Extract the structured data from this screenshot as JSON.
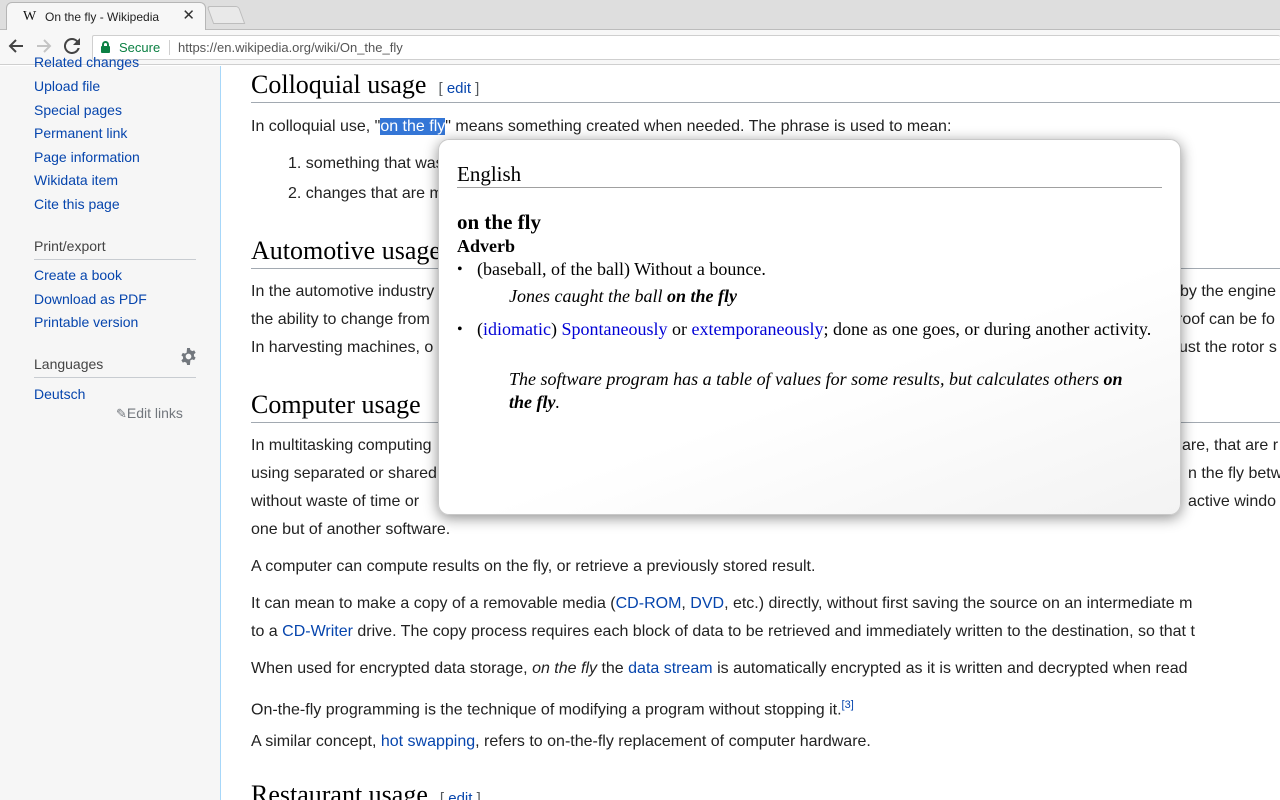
{
  "browser": {
    "tab_title": "On the fly - Wikipedia",
    "tab_favicon": "W",
    "tab_close": "✕",
    "secure_label": "Secure",
    "url": "https://en.wikipedia.org/wiki/On_the_fly"
  },
  "sidebar": {
    "tools_links": [
      "Related changes",
      "Upload file",
      "Special pages",
      "Permanent link",
      "Page information",
      "Wikidata item",
      "Cite this page"
    ],
    "print_heading": "Print/export",
    "print_links": [
      "Create a book",
      "Download as PDF",
      "Printable version"
    ],
    "languages_heading": "Languages",
    "languages": [
      "Deutsch"
    ],
    "edit_links": "Edit links"
  },
  "article": {
    "edit_label": "edit",
    "sections": {
      "colloquial_heading": "Colloquial usage",
      "automotive_heading": "Automotive usage",
      "computer_heading": "Computer usage",
      "restaurant_heading": "Restaurant usage"
    },
    "colloquial": {
      "intro_before": "In colloquial use, \"",
      "intro_selected": "on the fly",
      "intro_after": "\" means something created when needed. The phrase is used to mean:",
      "item1": "something that was",
      "item2": "changes that are m"
    },
    "automotive": {
      "line1_left": "In the automotive industry",
      "line1_right": "by the engine",
      "line2_left": "the ability to change from",
      "line2_right": "roof can be fo",
      "line3_left": "In harvesting machines, o",
      "line3_right": "ust the rotor s"
    },
    "computer": {
      "line1_left": "In multitasking computing",
      "line1_right": "are, that are r",
      "line2_left": "using separated or shared",
      "line2_right": "n the fly betw",
      "line3_left": "without waste of time or",
      "line3_right": "active windo",
      "line4": "one but of another software.",
      "p2": "A computer can compute results on the fly, or retrieve a previously stored result.",
      "p3a_1": "It can mean to make a copy of a removable media (",
      "p3a_link1": "CD-ROM",
      "p3a_2": ", ",
      "p3a_link2": "DVD",
      "p3a_3": ", etc.) directly, without first saving the source on an intermediate m",
      "p3b_1": "to a ",
      "p3b_link": "CD-Writer",
      "p3b_2": " drive. The copy process requires each block of data to be retrieved and immediately written to the destination, so that t",
      "p4_1": "When used for encrypted data storage, ",
      "p4_italic": "on the fly",
      "p4_2": " the ",
      "p4_link": "data stream",
      "p4_3": " is automatically encrypted as it is written and decrypted when read",
      "p5": "On-the-fly programming is the technique of modifying a program without stopping it.",
      "p5_ref": "[3]",
      "p6_1": "A similar concept, ",
      "p6_link": "hot swapping",
      "p6_2": ", refers to on-the-fly replacement of computer hardware."
    }
  },
  "popup": {
    "language": "English",
    "term": "on the fly",
    "part_of_speech": "Adverb",
    "def1": "(baseball, of the ball) Without a bounce.",
    "ex1_before": "Jones caught the ball ",
    "ex1_bold": "on the fly",
    "def2_open": "(",
    "def2_tag": "idiomatic",
    "def2_close": ") ",
    "def2_link1": "Spontaneously",
    "def2_or": " or ",
    "def2_link2": "extemporaneously",
    "def2_rest": "; done as one goes, or during another activity.",
    "ex2_before": "The software program has a table of values for some results, but calculates others ",
    "ex2_bold": "on the fly",
    "ex2_after": "."
  },
  "colors": {
    "link": "#0645ad",
    "selection": "#3476d6",
    "secure_green": "#0b8043",
    "popup_link": "#0000d6"
  },
  "icons": [
    "back-arrow-icon",
    "forward-arrow-icon",
    "reload-icon",
    "lock-icon",
    "gear-icon",
    "pencil-icon",
    "close-icon"
  ]
}
